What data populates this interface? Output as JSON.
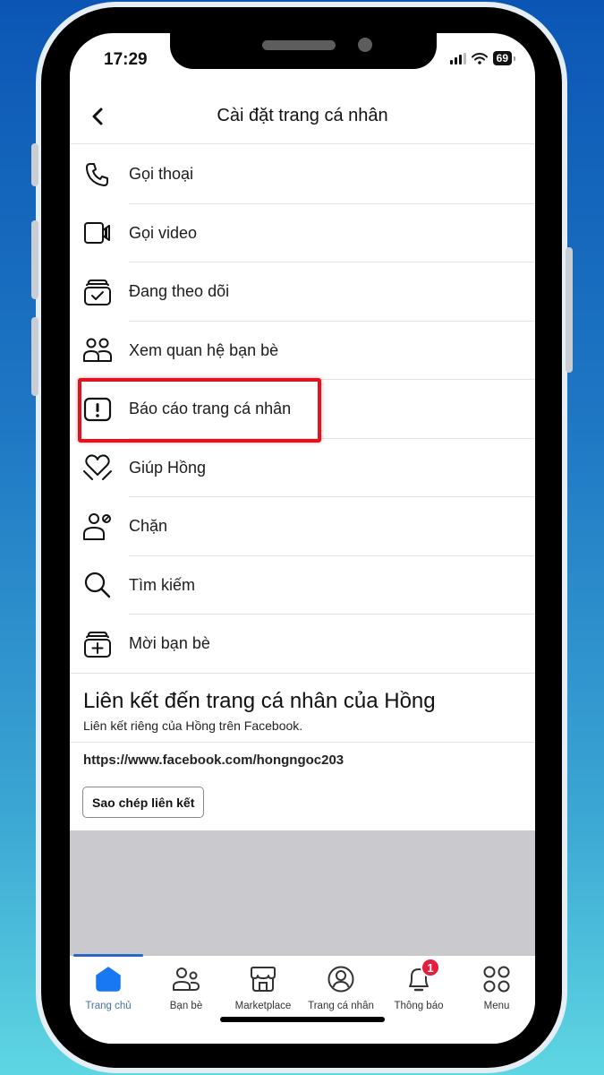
{
  "status_bar": {
    "time": "17:29",
    "battery": "69",
    "icons": [
      "signal-icon",
      "wifi-icon",
      "battery-icon"
    ]
  },
  "header": {
    "title": "Cài đặt trang cá nhân",
    "back_icon": "chevron-left-icon"
  },
  "menu": {
    "items": [
      {
        "label": "Gọi thoại",
        "icon": "phone-icon"
      },
      {
        "label": "Gọi video",
        "icon": "video-camera-icon"
      },
      {
        "label": "Đang theo dõi",
        "icon": "following-check-icon"
      },
      {
        "label": "Xem quan hệ bạn bè",
        "icon": "friends-icon"
      },
      {
        "label": "Báo cáo trang cá nhân",
        "icon": "report-exclamation-icon",
        "highlighted": true
      },
      {
        "label": "Giúp Hồng",
        "icon": "heart-hands-icon"
      },
      {
        "label": "Chặn",
        "icon": "block-user-icon"
      },
      {
        "label": "Tìm kiếm",
        "icon": "search-icon"
      },
      {
        "label": "Mời bạn bè",
        "icon": "invite-plus-icon"
      }
    ]
  },
  "profile_link": {
    "title": "Liên kết đến trang cá nhân của Hồng",
    "subtitle": "Liên kết riêng của Hồng trên Facebook.",
    "url": "https://www.facebook.com/hongngoc203",
    "copy_button": "Sao chép liên kết"
  },
  "tabbar": {
    "active": 0,
    "tabs": [
      {
        "label": "Trang chủ",
        "icon": "home-icon"
      },
      {
        "label": "Bạn bè",
        "icon": "friends-icon"
      },
      {
        "label": "Marketplace",
        "icon": "marketplace-icon"
      },
      {
        "label": "Trang cá nhân",
        "icon": "profile-icon"
      },
      {
        "label": "Thông báo",
        "icon": "bell-icon",
        "badge": "1"
      },
      {
        "label": "Menu",
        "icon": "menu-grid-icon"
      }
    ]
  },
  "colors": {
    "accent": "#1877f2",
    "highlight_box": "#e0141f",
    "badge": "#e41e3f"
  }
}
